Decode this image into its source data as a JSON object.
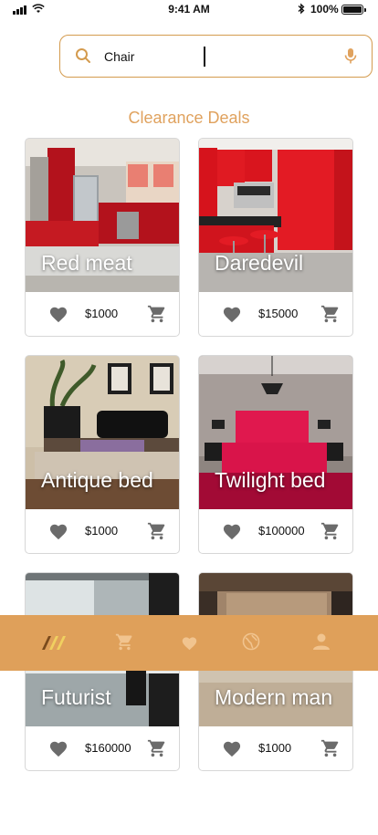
{
  "status_bar": {
    "time": "9:41 AM",
    "battery": "100%"
  },
  "search": {
    "value": "Chair",
    "placeholder": ""
  },
  "section": {
    "title": "Clearance Deals"
  },
  "products": [
    {
      "title": "Red meat",
      "price": "$1000"
    },
    {
      "title": "Daredevil",
      "price": "$15000"
    },
    {
      "title": "Antique bed",
      "price": "$1000"
    },
    {
      "title": "Twilight bed",
      "price": "$100000"
    },
    {
      "title": "Futurist",
      "price": "$160000"
    },
    {
      "title": "Modern man",
      "price": "$1000"
    }
  ],
  "nav": {
    "items": [
      {
        "icon": "home-logo-icon",
        "active": true
      },
      {
        "icon": "cart-icon",
        "active": false
      },
      {
        "icon": "heart-icon",
        "active": false
      },
      {
        "icon": "globe-icon",
        "active": false
      },
      {
        "icon": "person-icon",
        "active": false
      }
    ]
  },
  "colors": {
    "accent": "#dfa05a",
    "title": "#e0a25e",
    "icon_gray": "#6b6b6b"
  }
}
